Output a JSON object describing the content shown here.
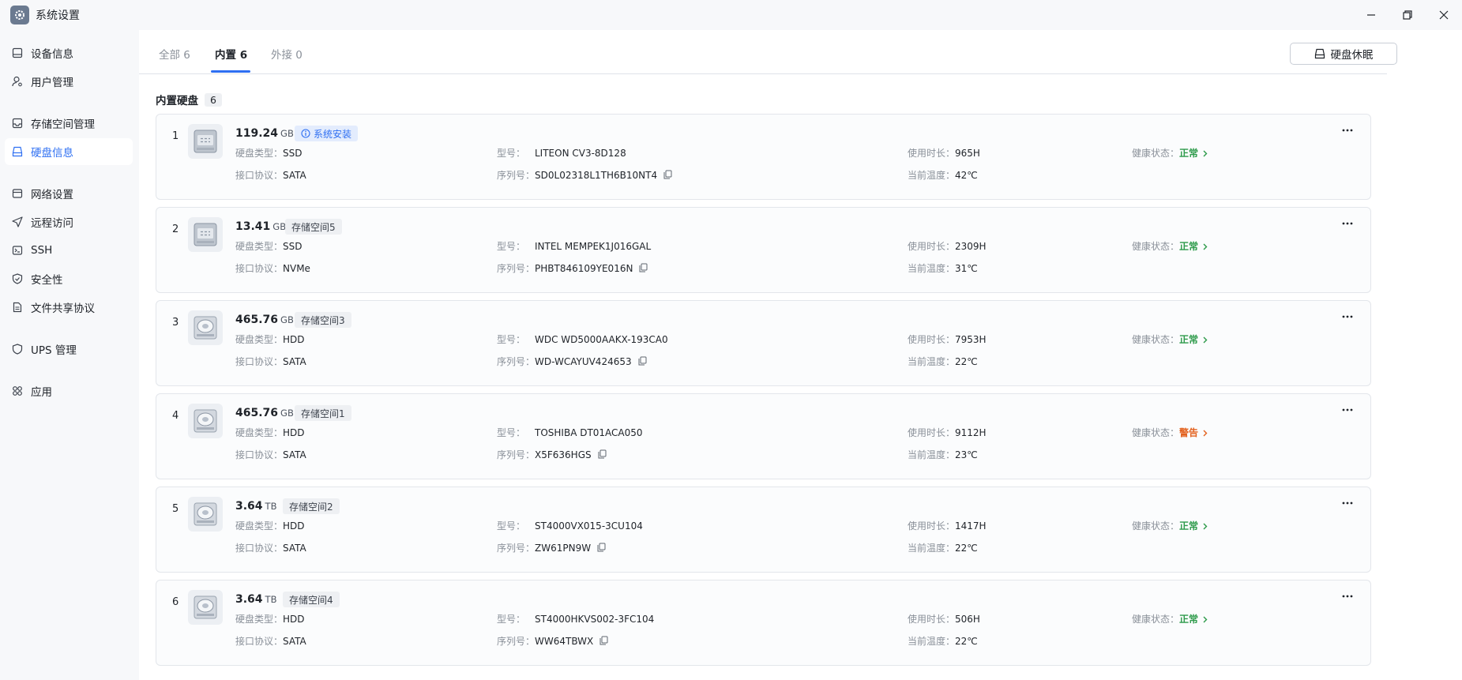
{
  "window": {
    "title": "系统设置",
    "app_icon": "gear-icon"
  },
  "sidebar": {
    "items": [
      {
        "key": "device",
        "label": "设备信息",
        "icon": "device-icon"
      },
      {
        "key": "users",
        "label": "用户管理",
        "icon": "user-icon"
      },
      {
        "key": "storage",
        "label": "存储空间管理",
        "icon": "storage-icon"
      },
      {
        "key": "disks",
        "label": "硬盘信息",
        "icon": "disk-icon",
        "active": true
      },
      {
        "key": "network",
        "label": "网络设置",
        "icon": "network-icon"
      },
      {
        "key": "remote",
        "label": "远程访问",
        "icon": "send-icon"
      },
      {
        "key": "ssh",
        "label": "SSH",
        "icon": "terminal-icon"
      },
      {
        "key": "security",
        "label": "安全性",
        "icon": "shield-icon"
      },
      {
        "key": "share",
        "label": "文件共享协议",
        "icon": "document-icon"
      },
      {
        "key": "ups",
        "label": "UPS 管理",
        "icon": "ups-shield-icon"
      },
      {
        "key": "apps",
        "label": "应用",
        "icon": "apps-icon"
      }
    ]
  },
  "tabs": [
    {
      "label": "全部 6"
    },
    {
      "label": "内置 6",
      "active": true
    },
    {
      "label": "外接 0"
    }
  ],
  "toolbar": {
    "sleep_label": "硬盘休眠"
  },
  "section": {
    "title": "内置硬盘",
    "count": "6"
  },
  "labels": {
    "disk_type": "硬盘类型：",
    "interface": "接口协议：",
    "model": "型号：",
    "serial": "序列号：",
    "usage": "使用时长：",
    "temperature": "当前温度：",
    "health": "健康状态："
  },
  "colors": {
    "accent": "#2e6ff2",
    "ok": "#2e9b4b",
    "warn": "#e3621f"
  },
  "disks": [
    {
      "index": "1",
      "size": "119.24",
      "unit": "GB",
      "badge": "系统安装",
      "badge_type": "sys",
      "icon": "ssd-icon",
      "type": "SSD",
      "interface": "SATA",
      "model": "LITEON CV3-8D128",
      "serial": "SD0L02318L1TH6B10NT4",
      "usage": "965H",
      "temperature": "42℃",
      "health": "正常",
      "health_status": "ok"
    },
    {
      "index": "2",
      "size": "13.41",
      "unit": "GB",
      "badge": "存储空间5",
      "badge_type": "pool",
      "icon": "ssd-icon",
      "type": "SSD",
      "interface": "NVMe",
      "model": "INTEL MEMPEK1J016GAL",
      "serial": "PHBT846109YE016N",
      "usage": "2309H",
      "temperature": "31℃",
      "health": "正常",
      "health_status": "ok"
    },
    {
      "index": "3",
      "size": "465.76",
      "unit": "GB",
      "badge": "存储空间3",
      "badge_type": "pool",
      "icon": "hdd-icon",
      "type": "HDD",
      "interface": "SATA",
      "model": "WDC WD5000AAKX-193CA0",
      "serial": "WD-WCAYUV424653",
      "usage": "7953H",
      "temperature": "22℃",
      "health": "正常",
      "health_status": "ok"
    },
    {
      "index": "4",
      "size": "465.76",
      "unit": "GB",
      "badge": "存储空间1",
      "badge_type": "pool",
      "icon": "hdd-icon",
      "type": "HDD",
      "interface": "SATA",
      "model": "TOSHIBA DT01ACA050",
      "serial": "X5F636HGS",
      "usage": "9112H",
      "temperature": "23℃",
      "health": "警告",
      "health_status": "warn"
    },
    {
      "index": "5",
      "size": "3.64",
      "unit": "TB",
      "badge": "存储空间2",
      "badge_type": "pool",
      "icon": "hdd-icon",
      "type": "HDD",
      "interface": "SATA",
      "model": "ST4000VX015-3CU104",
      "serial": "ZW61PN9W",
      "usage": "1417H",
      "temperature": "22℃",
      "health": "正常",
      "health_status": "ok"
    },
    {
      "index": "6",
      "size": "3.64",
      "unit": "TB",
      "badge": "存储空间4",
      "badge_type": "pool",
      "icon": "hdd-icon",
      "type": "HDD",
      "interface": "SATA",
      "model": "ST4000HKVS002-3FC104",
      "serial": "WW64TBWX",
      "usage": "506H",
      "temperature": "22℃",
      "health": "正常",
      "health_status": "ok"
    }
  ]
}
